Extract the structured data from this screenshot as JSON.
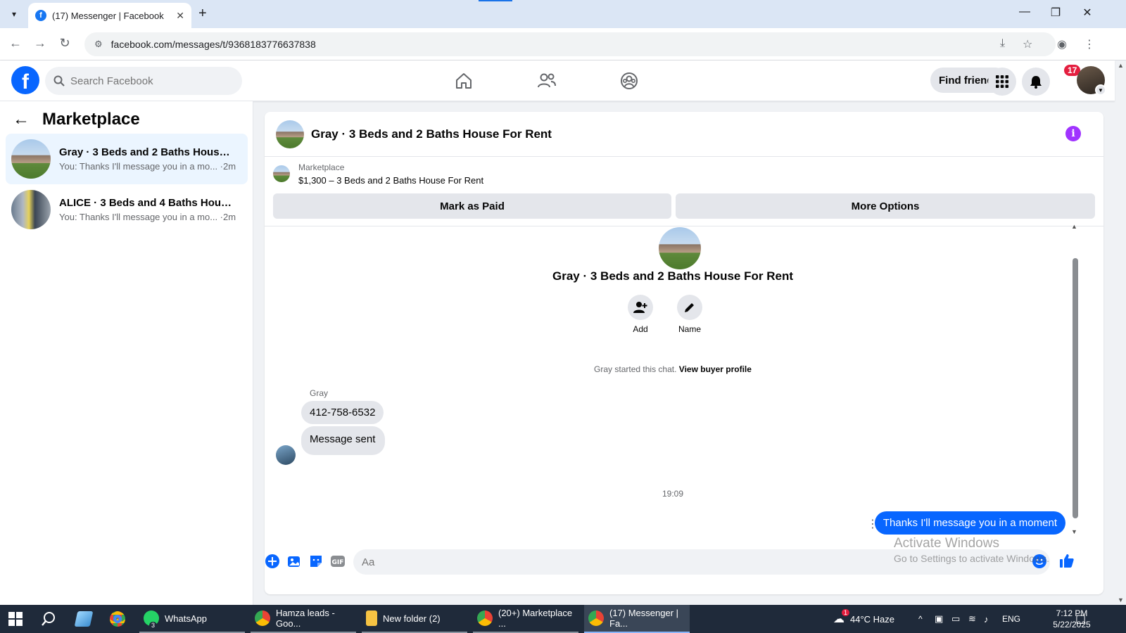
{
  "browser": {
    "tab_title": "(17) Messenger | Facebook",
    "url": "facebook.com/messages/t/9368183776637838"
  },
  "facebook": {
    "search_placeholder": "Search Facebook",
    "find_friends": "Find friends",
    "notification_count": "17"
  },
  "sidebar": {
    "title": "Marketplace",
    "conversations": [
      {
        "name": "Gray · 3 Beds and 2 Baths House F...",
        "preview": "You: Thanks I'll message you in a mo... ·2m"
      },
      {
        "name": "ALICE · 3 Beds and 4 Baths House ...",
        "preview": "You: Thanks I'll message you in a mo... ·2m"
      }
    ]
  },
  "chat": {
    "title": "Gray · 3 Beds and 2 Baths House For Rent",
    "listing_label": "Marketplace",
    "listing_price": "$1,300 – 3 Beds and 2 Baths House For Rent",
    "mark_paid": "Mark as Paid",
    "more_options": "More Options",
    "profile_name": "Gray · 3 Beds and 2 Baths House For Rent",
    "add_label": "Add",
    "name_label": "Name",
    "started_text": "Gray started this chat.",
    "view_profile": "View buyer profile",
    "sender": "Gray",
    "messages_in": [
      "412-758-6532",
      "Message sent"
    ],
    "timestamp": "19:09",
    "message_out": "Thanks I'll message you in a moment",
    "input_placeholder": "Aa"
  },
  "watermark": {
    "line1": "Activate Windows",
    "line2": "Go to Settings to activate Windows."
  },
  "taskbar": {
    "items": [
      "WhatsApp",
      "Hamza leads - Goo...",
      "New folder (2)",
      "(20+) Marketplace ...",
      "(17) Messenger | Fa..."
    ],
    "whatsapp_badge": "3",
    "weather": "44°C  Haze",
    "weather_badge": "1",
    "lang": "ENG",
    "time": "7:12 PM",
    "date": "5/22/2025"
  },
  "colors": {
    "fb_blue": "#0866ff",
    "badge_red": "#e41e3f",
    "info_purple": "#a033ff"
  }
}
